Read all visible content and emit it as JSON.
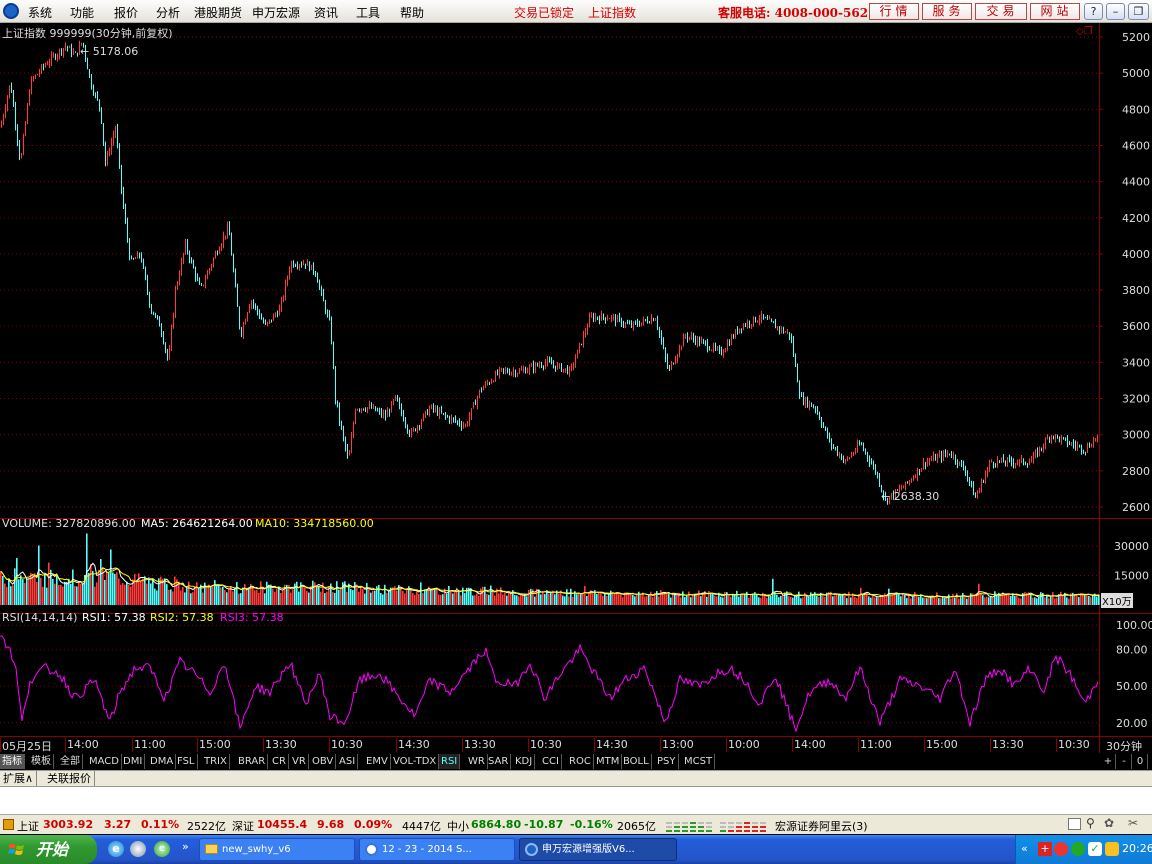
{
  "menubar": {
    "items": [
      "系统",
      "功能",
      "报价",
      "分析",
      "港股期货",
      "申万宏源",
      "资讯",
      "工具",
      "帮助"
    ],
    "status1": "交易已锁定",
    "status2": "上证指数",
    "hotline": "客服电话: 4008-000-562",
    "buttons": [
      "行情",
      "服务",
      "交易",
      "网站"
    ]
  },
  "price": {
    "title": "上证指数 999999(30分钟,前复权)",
    "high_label": "5178.06",
    "low_label": "2638.30",
    "y_ticks": [
      "5200",
      "5000",
      "4800",
      "4600",
      "4400",
      "4200",
      "4000",
      "3800",
      "3600",
      "3400",
      "3200",
      "3000",
      "2800",
      "2600"
    ]
  },
  "volume": {
    "label": "VOLUME: 327820896.00",
    "ma5": "MA5: 264621264.00",
    "ma10": "MA10: 334718560.00",
    "y_ticks": [
      "30000",
      "15000"
    ],
    "unit": "X10万"
  },
  "rsi": {
    "label": "RSI(14,14,14)",
    "rsi1": "RSI1: 57.38",
    "rsi2": "RSI2: 57.38",
    "rsi3": "RSI3: 57.38",
    "y_ticks": [
      "100.00",
      "80.00",
      "50.00",
      "20.00"
    ]
  },
  "time_axis": {
    "labels": [
      "05月25日",
      "14:00",
      "11:00",
      "15:00",
      "13:30",
      "10:30",
      "14:30",
      "13:30",
      "10:30",
      "14:30",
      "13:00",
      "10:00",
      "14:00",
      "11:00",
      "15:00",
      "13:30",
      "10:30"
    ],
    "period": "30分钟"
  },
  "indicator_tabs": [
    "指标",
    "模板",
    "全部",
    "MACD",
    "DMI",
    "DMA",
    "FSL",
    "TRIX",
    "BRAR",
    "CR",
    "VR",
    "OBV",
    "ASI",
    "EMV",
    "VOL-TDX",
    "RSI",
    "WR",
    "SAR",
    "KDJ",
    "CCI",
    "ROC",
    "MTM",
    "BOLL",
    "PSY",
    "MCST"
  ],
  "tab_controls": [
    "+",
    "-",
    "0"
  ],
  "expand_bar": {
    "items": [
      "扩展∧",
      "关联报价"
    ]
  },
  "ticker": {
    "sh_name": "上证",
    "sh_value": "3003.92",
    "sh_change": "3.27",
    "sh_pct": "0.11%",
    "sh_amount": "2522亿",
    "sz_name": "深证",
    "sz_value": "10455.4",
    "sz_change": "9.68",
    "sz_pct": "0.09%",
    "sz_amount": "4447亿",
    "zx_name": "中小",
    "zx_value": "6864.80",
    "zx_change": "-10.87",
    "zx_pct": "-0.16%",
    "zx_amount": "2065亿",
    "server": "宏源证券阿里云(3)"
  },
  "taskbar": {
    "start": "开始",
    "tasks": [
      "new_swhy_v6",
      "12 - 23 - 2014 S...",
      "申万宏源增强版V6..."
    ],
    "clock": "20:26"
  },
  "colors": {
    "up": "#ff3b3b",
    "down": "#54ffff",
    "ma5": "#ffffff",
    "ma10": "#ffff00",
    "rsi": "#ff00ff",
    "grid": "#8a0000"
  },
  "chart_data": {
    "type": "line",
    "title": "上证指数 999999(30分钟,前复权)",
    "price_path": [
      [
        0,
        4700
      ],
      [
        10,
        4950
      ],
      [
        20,
        4500
      ],
      [
        30,
        4950
      ],
      [
        45,
        5050
      ],
      [
        55,
        5100
      ],
      [
        65,
        5150
      ],
      [
        75,
        5100
      ],
      [
        82,
        5178.06
      ],
      [
        90,
        4950
      ],
      [
        100,
        4800
      ],
      [
        105,
        4500
      ],
      [
        115,
        4700
      ],
      [
        122,
        4300
      ],
      [
        130,
        3950
      ],
      [
        140,
        4000
      ],
      [
        150,
        3700
      ],
      [
        160,
        3600
      ],
      [
        168,
        3400
      ],
      [
        175,
        3800
      ],
      [
        185,
        4050
      ],
      [
        200,
        3800
      ],
      [
        215,
        4000
      ],
      [
        228,
        4150
      ],
      [
        235,
        3800
      ],
      [
        240,
        3550
      ],
      [
        250,
        3750
      ],
      [
        265,
        3600
      ],
      [
        280,
        3700
      ],
      [
        290,
        3950
      ],
      [
        305,
        3950
      ],
      [
        315,
        3900
      ],
      [
        322,
        3750
      ],
      [
        330,
        3600
      ],
      [
        335,
        3200
      ],
      [
        340,
        3050
      ],
      [
        348,
        2850
      ],
      [
        355,
        3150
      ],
      [
        370,
        3150
      ],
      [
        385,
        3100
      ],
      [
        395,
        3200
      ],
      [
        410,
        3000
      ],
      [
        430,
        3150
      ],
      [
        445,
        3100
      ],
      [
        465,
        3050
      ],
      [
        480,
        3250
      ],
      [
        500,
        3350
      ],
      [
        520,
        3350
      ],
      [
        545,
        3400
      ],
      [
        570,
        3350
      ],
      [
        590,
        3650
      ],
      [
        610,
        3650
      ],
      [
        630,
        3600
      ],
      [
        655,
        3650
      ],
      [
        668,
        3350
      ],
      [
        685,
        3550
      ],
      [
        705,
        3500
      ],
      [
        720,
        3450
      ],
      [
        740,
        3600
      ],
      [
        760,
        3650
      ],
      [
        775,
        3600
      ],
      [
        790,
        3550
      ],
      [
        800,
        3200
      ],
      [
        815,
        3150
      ],
      [
        830,
        2950
      ],
      [
        845,
        2850
      ],
      [
        860,
        2950
      ],
      [
        875,
        2800
      ],
      [
        885,
        2638.3
      ],
      [
        905,
        2720
      ],
      [
        925,
        2850
      ],
      [
        950,
        2900
      ],
      [
        965,
        2800
      ],
      [
        975,
        2650
      ],
      [
        990,
        2850
      ],
      [
        1010,
        2850
      ],
      [
        1030,
        2850
      ],
      [
        1050,
        3000
      ],
      [
        1070,
        2950
      ],
      [
        1085,
        2920
      ],
      [
        1099,
        3003.92
      ]
    ],
    "volume_profile": [
      [
        0,
        0.75
      ],
      [
        100,
        0.85
      ],
      [
        200,
        0.5
      ],
      [
        330,
        0.55
      ],
      [
        400,
        0.45
      ],
      [
        600,
        0.35
      ],
      [
        800,
        0.3
      ],
      [
        1000,
        0.28
      ],
      [
        1099,
        0.3
      ]
    ],
    "rsi_path": [
      [
        0,
        95
      ],
      [
        15,
        70
      ],
      [
        22,
        20
      ],
      [
        30,
        55
      ],
      [
        45,
        65
      ],
      [
        60,
        60
      ],
      [
        75,
        40
      ],
      [
        95,
        55
      ],
      [
        110,
        20
      ],
      [
        120,
        45
      ],
      [
        135,
        65
      ],
      [
        150,
        65
      ],
      [
        165,
        40
      ],
      [
        180,
        70
      ],
      [
        195,
        60
      ],
      [
        210,
        45
      ],
      [
        225,
        70
      ],
      [
        240,
        15
      ],
      [
        255,
        50
      ],
      [
        270,
        45
      ],
      [
        290,
        70
      ],
      [
        305,
        35
      ],
      [
        320,
        60
      ],
      [
        330,
        25
      ],
      [
        345,
        20
      ],
      [
        360,
        55
      ],
      [
        380,
        60
      ],
      [
        400,
        40
      ],
      [
        415,
        25
      ],
      [
        430,
        55
      ],
      [
        450,
        45
      ],
      [
        470,
        65
      ],
      [
        485,
        80
      ],
      [
        495,
        55
      ],
      [
        515,
        50
      ],
      [
        530,
        70
      ],
      [
        545,
        40
      ],
      [
        560,
        60
      ],
      [
        580,
        80
      ],
      [
        595,
        60
      ],
      [
        610,
        40
      ],
      [
        625,
        55
      ],
      [
        645,
        65
      ],
      [
        665,
        20
      ],
      [
        680,
        55
      ],
      [
        700,
        50
      ],
      [
        715,
        60
      ],
      [
        730,
        65
      ],
      [
        745,
        55
      ],
      [
        760,
        35
      ],
      [
        775,
        60
      ],
      [
        795,
        15
      ],
      [
        810,
        45
      ],
      [
        830,
        55
      ],
      [
        845,
        40
      ],
      [
        860,
        65
      ],
      [
        880,
        20
      ],
      [
        900,
        55
      ],
      [
        920,
        50
      ],
      [
        940,
        40
      ],
      [
        955,
        65
      ],
      [
        970,
        20
      ],
      [
        985,
        55
      ],
      [
        1000,
        65
      ],
      [
        1015,
        50
      ],
      [
        1030,
        65
      ],
      [
        1045,
        45
      ],
      [
        1055,
        75
      ],
      [
        1070,
        60
      ],
      [
        1085,
        35
      ],
      [
        1099,
        57.38
      ]
    ],
    "price_ylim": [
      2600,
      5200
    ],
    "volume_ylim": [
      0,
      33000
    ],
    "rsi_ylim": [
      10,
      110
    ]
  }
}
